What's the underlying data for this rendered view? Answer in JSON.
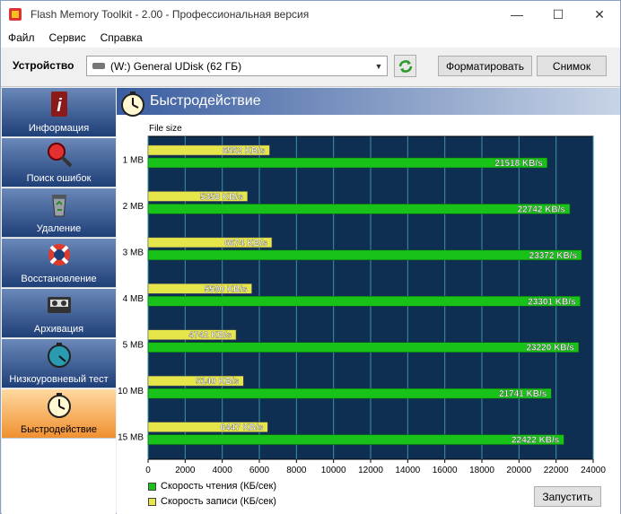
{
  "window": {
    "title": "Flash Memory Toolkit - 2.00 - Профессиональная версия",
    "minimize": "—",
    "maximize": "☐",
    "close": "✕"
  },
  "menu": [
    "Файл",
    "Сервис",
    "Справка"
  ],
  "device": {
    "label": "Устройство",
    "selected": "(W:) General UDisk (62 ГБ)",
    "format_button": "Форматировать",
    "snapshot_button": "Снимок"
  },
  "sidebar": [
    {
      "label": "Информация",
      "icon": "info-icon"
    },
    {
      "label": "Поиск ошибок",
      "icon": "magnifier-icon"
    },
    {
      "label": "Удаление",
      "icon": "recycle-bin-icon"
    },
    {
      "label": "Восстановление",
      "icon": "lifebuoy-icon"
    },
    {
      "label": "Архивация",
      "icon": "tape-icon"
    },
    {
      "label": "Низкоуровневый тест",
      "icon": "stopwatch-icon"
    },
    {
      "label": "Быстродействие",
      "icon": "clock-icon",
      "active": true
    }
  ],
  "section": {
    "title": "Быстродействие"
  },
  "legend": {
    "read": "Скорость чтения (КБ/сек)",
    "write": "Скорость записи (КБ/сек)"
  },
  "start_button": "Запустить",
  "colors": {
    "read": "#19c219",
    "write": "#e6e64a",
    "plot_bg": "#0f2f52",
    "grid": "#3e90a8"
  },
  "chart_data": {
    "type": "bar",
    "orientation": "horizontal",
    "ylabel": "File size",
    "categories": [
      "1 MB",
      "2 MB",
      "3 MB",
      "4 MB",
      "5 MB",
      "10 MB",
      "15 MB"
    ],
    "series": [
      {
        "name": "Скорость записи (КБ/сек)",
        "values": [
          6552,
          5358,
          6674,
          5590,
          4742,
          5140,
          6447
        ],
        "labels": [
          "6552 KB/s",
          "5358 KB/s",
          "6674 KB/s",
          "5590 KB/s",
          "4742 KB/s",
          "5140 KB/s",
          "6447 KB/s"
        ]
      },
      {
        "name": "Скорость чтения (КБ/сек)",
        "values": [
          21518,
          22742,
          23372,
          23301,
          23220,
          21741,
          22422
        ],
        "labels": [
          "21518 KB/s",
          "22742 KB/s",
          "23372 KB/s",
          "23301 KB/s",
          "23220 KB/s",
          "21741 KB/s",
          "22422 KB/s"
        ]
      }
    ],
    "xlim": [
      0,
      24000
    ],
    "xticks": [
      "0",
      "2000",
      "4000",
      "6000",
      "8000",
      "10000",
      "12000",
      "14000",
      "16000",
      "18000",
      "20000",
      "22000",
      "24000"
    ],
    "grid": true
  }
}
